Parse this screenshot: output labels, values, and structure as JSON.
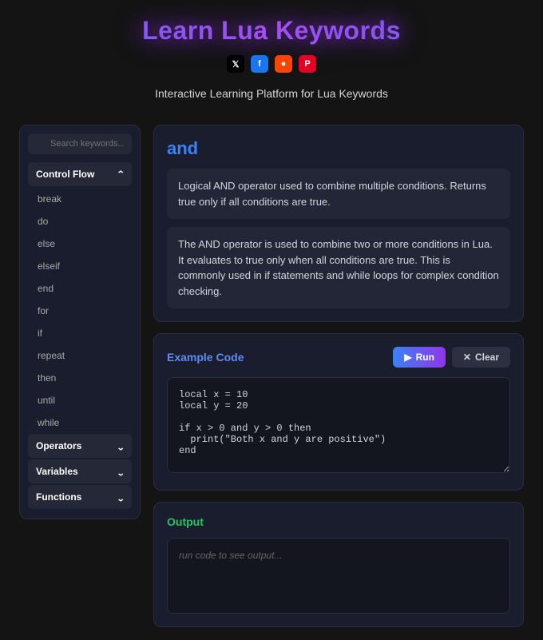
{
  "header": {
    "title": "Learn Lua Keywords",
    "subtitle": "Interactive Learning Platform for Lua Keywords"
  },
  "social": {
    "x": "𝕏",
    "facebook": "f",
    "reddit": "●",
    "pinterest": "P"
  },
  "sidebar": {
    "search_placeholder": "Search keywords...",
    "categories": [
      {
        "name": "Control Flow",
        "expanded": true,
        "items": [
          "break",
          "do",
          "else",
          "elseif",
          "end",
          "for",
          "if",
          "repeat",
          "then",
          "until",
          "while"
        ]
      },
      {
        "name": "Operators",
        "expanded": false
      },
      {
        "name": "Variables",
        "expanded": false
      },
      {
        "name": "Functions",
        "expanded": false
      }
    ]
  },
  "main": {
    "keyword": "and",
    "short_description": "Logical AND operator used to combine multiple conditions. Returns true only if all conditions are true.",
    "long_description": "The AND operator is used to combine two or more conditions in Lua. It evaluates to true only when all conditions are true. This is commonly used in if statements and while loops for complex condition checking.",
    "example_title": "Example Code",
    "run_label": "Run",
    "clear_label": "Clear",
    "code": "local x = 10\nlocal y = 20\n\nif x > 0 and y > 0 then\n  print(\"Both x and y are positive\")\nend",
    "output_title": "Output",
    "output_placeholder": "run code to see output..."
  }
}
